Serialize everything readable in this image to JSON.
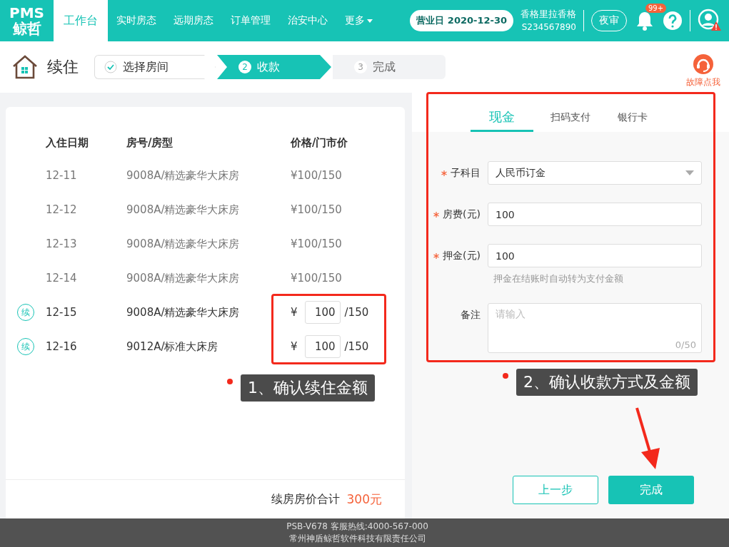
{
  "header": {
    "logo": [
      "PMS",
      "鲸哲"
    ],
    "nav": [
      {
        "label": "工作台",
        "selected": true
      },
      {
        "label": "实时房态",
        "selected": false
      },
      {
        "label": "远期房态",
        "selected": false
      },
      {
        "label": "订单管理",
        "selected": false
      },
      {
        "label": "治安中心",
        "selected": false
      },
      {
        "label": "更多",
        "selected": false
      }
    ],
    "business_day": "营业日 2020-12-30",
    "hotel_name": "香格里拉香格",
    "hotel_code": "S234567890",
    "night_audit": "夜审",
    "notification_count": "99+"
  },
  "page": {
    "title": "续住",
    "help_label": "故障点我",
    "steps": [
      {
        "label": "选择房间",
        "done": true,
        "selected": false
      },
      {
        "number": "2",
        "label": "收款",
        "done": false,
        "selected": true
      },
      {
        "number": "3",
        "label": "完成",
        "done": false,
        "selected": false
      }
    ]
  },
  "table": {
    "columns": [
      "入住日期",
      "房号/房型",
      "价格/门市价"
    ],
    "rows": [
      {
        "kind": "fixed",
        "date": "12-11",
        "room": "9008A/精选豪华大床房",
        "price": "¥100/150"
      },
      {
        "kind": "fixed",
        "date": "12-12",
        "room": "9008A/精选豪华大床房",
        "price": "¥100/150"
      },
      {
        "kind": "fixed",
        "date": "12-13",
        "room": "9008A/精选豪华大床房",
        "price": "¥100/150"
      },
      {
        "kind": "fixed",
        "date": "12-14",
        "room": "9008A/精选豪华大床房",
        "price": "¥100/150"
      },
      {
        "kind": "editable",
        "mark": "续",
        "date": "12-15",
        "room": "9008A/精选豪华大床房",
        "currency": "¥",
        "value": "100",
        "list_price": "/150"
      },
      {
        "kind": "editable",
        "mark": "续",
        "date": "12-16",
        "room": "9012A/标准大床房",
        "currency": "¥",
        "value": "100",
        "list_price": "/150"
      }
    ]
  },
  "total": {
    "label": "续房房价合计",
    "amount": "300元"
  },
  "payment": {
    "tabs": [
      {
        "label": "现金",
        "selected": true
      },
      {
        "label": "扫码支付",
        "selected": false
      },
      {
        "label": "银行卡",
        "selected": false
      }
    ],
    "fields": [
      {
        "kind": "select",
        "required": true,
        "label": "子科目",
        "value": "人民币订金"
      },
      {
        "kind": "input",
        "required": true,
        "label": "房费(元)",
        "value": "100"
      },
      {
        "kind": "input",
        "required": true,
        "label": "押金(元)",
        "value": "100",
        "hint": "押金在结账时自动转为支付金额"
      },
      {
        "kind": "textarea",
        "required": false,
        "label": "备注",
        "placeholder": "请输入",
        "counter": "0/50"
      }
    ]
  },
  "buttons": [
    {
      "label": "上一步",
      "kind": "secondary"
    },
    {
      "label": "完成",
      "kind": "primary"
    }
  ],
  "annotations": [
    {
      "text": "1、确认续住金额"
    },
    {
      "text": "2、确认收款方式及金额"
    }
  ],
  "footer": {
    "lines": [
      "PSB-V678  客服热线:4000-567-000",
      "常州神盾鲸哲软件科技有限责任公司"
    ]
  }
}
